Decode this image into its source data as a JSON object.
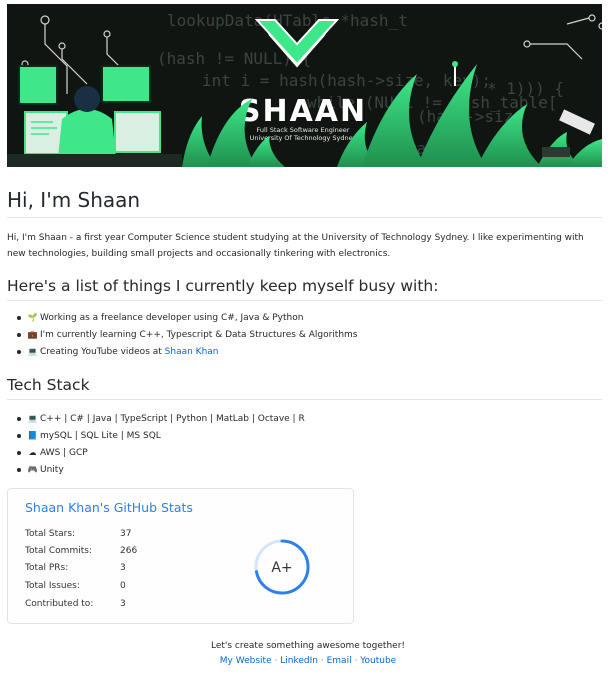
{
  "banner": {
    "brand": "SHAAN",
    "subtitle_line1": "Full Stack Software Engineer",
    "subtitle_line2": "University Of Technology Sydney",
    "code_snippets": [
      "lookupData(HTable *hash_t",
      "(hash != NULL) {",
      "int i = hash(hash->size, key);",
      "while (NULL != hash_table[",
      "(hash->size",
      "* 1))) {",
      "rable"
    ]
  },
  "intro": {
    "heading": "Hi, I'm Shaan",
    "paragraph": "Hi, I'm Shaan - a first year Computer Science student studying at the University of Technology Sydney. I like experimenting with new technologies, building small projects and occasionally tinkering with electronics."
  },
  "busy": {
    "heading": "Here's a list of things I currently keep myself busy with:",
    "items": [
      {
        "icon": "seedling-icon",
        "glyph": "🌱",
        "prefix": "Working as a freelance developer using ",
        "bold": "C#, Java & Python",
        "link": ""
      },
      {
        "icon": "briefcase-icon",
        "glyph": "💼",
        "prefix": "I'm currently learning ",
        "bold": "C++, Typescript & Data Structures & Algorithms",
        "link": ""
      },
      {
        "icon": "laptop-icon",
        "glyph": "💻",
        "prefix": "Creating YouTube videos at ",
        "bold": "",
        "link": "Shaan Khan"
      }
    ]
  },
  "tech": {
    "heading": "Tech Stack",
    "items": [
      {
        "icon": "laptop-icon",
        "glyph": "💻",
        "text": "C++ | C# | Java | TypeScript | Python | MatLab | Octave | R"
      },
      {
        "icon": "book-icon",
        "glyph": "📘",
        "text": "mySQL | SQL Lite | MS SQL"
      },
      {
        "icon": "cloud-icon",
        "glyph": "☁",
        "text": "AWS | GCP"
      },
      {
        "icon": "gamepad-icon",
        "glyph": "🎮",
        "text": "Unity"
      }
    ]
  },
  "stats": {
    "title": "Shaan Khan's GitHub Stats",
    "rows": [
      {
        "label": "Total Stars:",
        "value": "37"
      },
      {
        "label": "Total Commits:",
        "value": "266"
      },
      {
        "label": "Total PRs:",
        "value": "3"
      },
      {
        "label": "Total Issues:",
        "value": "0"
      },
      {
        "label": "Contributed to:",
        "value": "3"
      }
    ],
    "rank": "A+",
    "rank_progress": 0.72,
    "accent": "#2f80ed"
  },
  "footer": {
    "tagline": "Let's create something awesome together!",
    "links": [
      "My Website",
      "LinkedIn",
      "Email",
      "Youtube"
    ],
    "separator": "·"
  }
}
